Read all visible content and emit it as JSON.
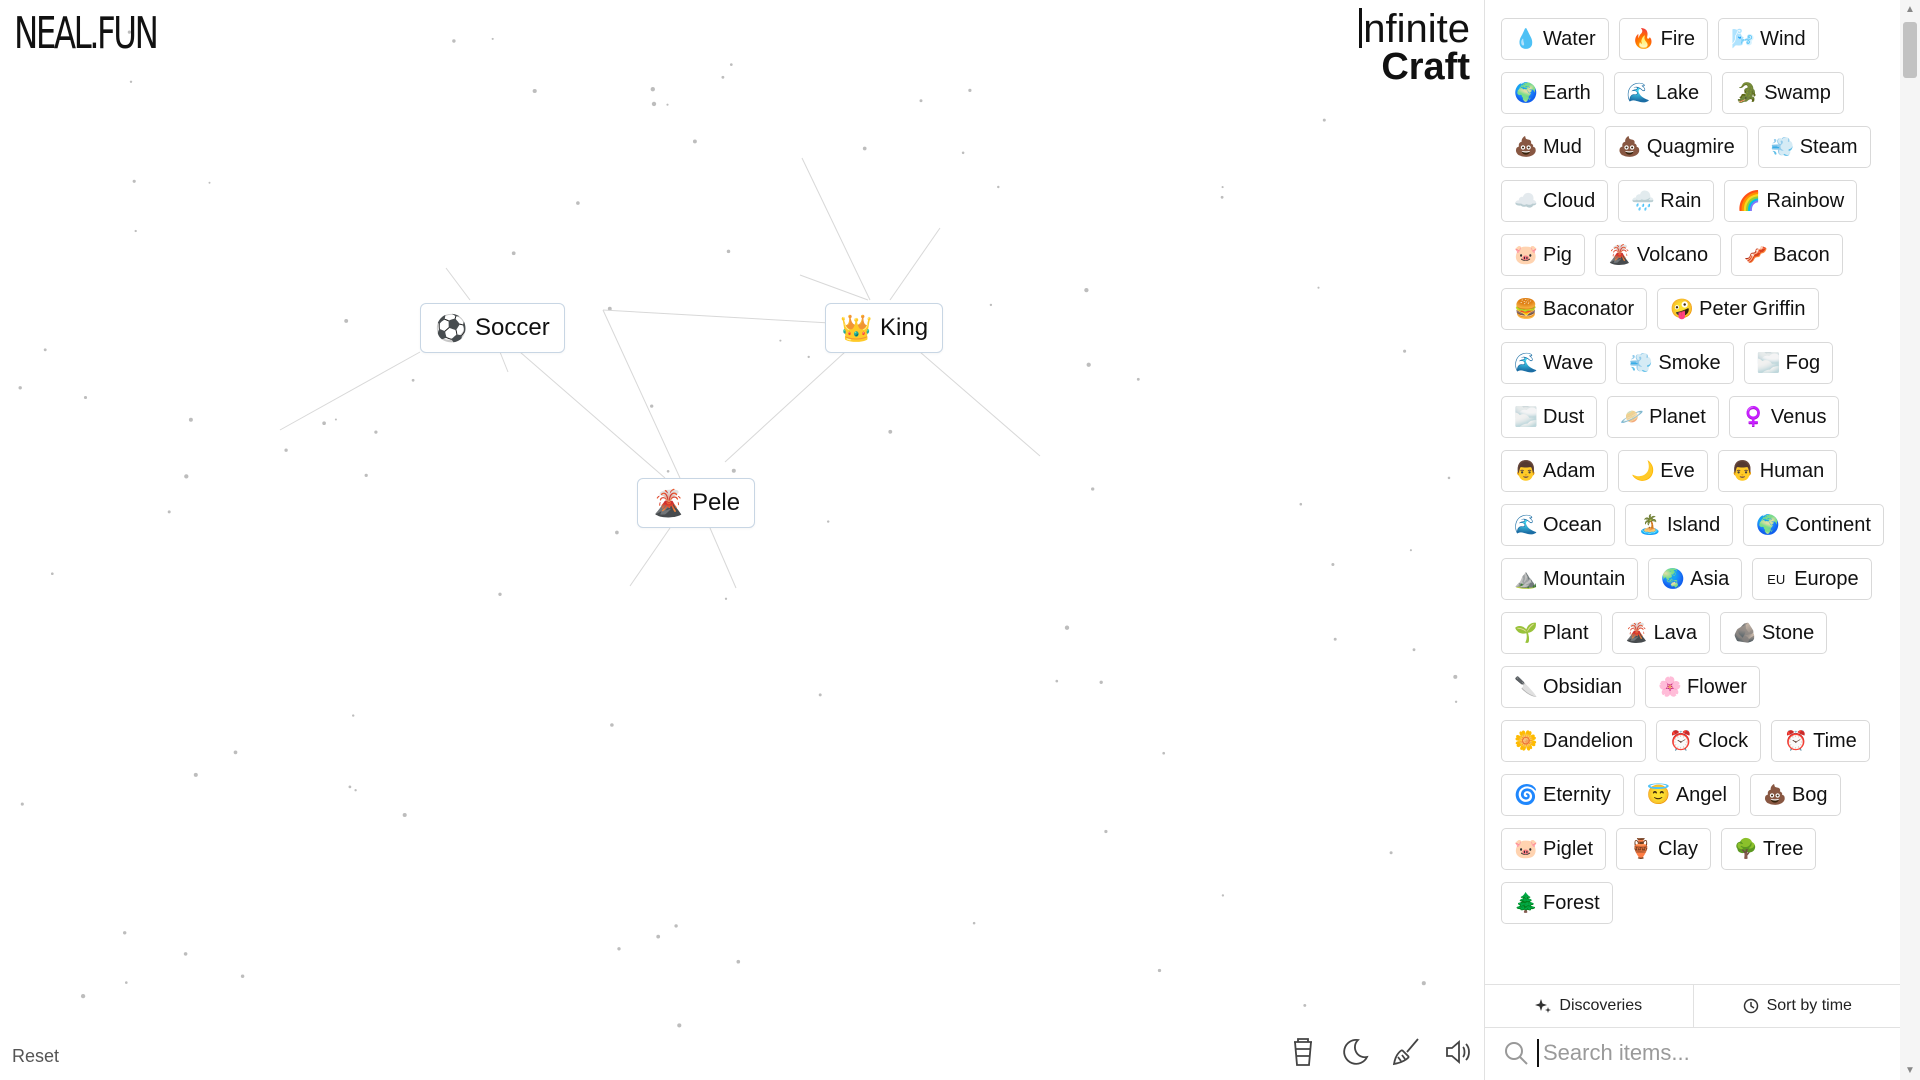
{
  "header": {
    "site_logo": "NEAL.FUN",
    "brand_line1": "nfinite",
    "brand_line2": "Craft"
  },
  "canvas": {
    "nodes": [
      {
        "label": "Soccer",
        "emoji": "⚽",
        "icon": "soccer-ball-icon"
      },
      {
        "label": "King",
        "emoji": "👑",
        "icon": "crown-icon"
      },
      {
        "label": "Pele",
        "emoji": "🌋",
        "icon": "volcano-icon"
      }
    ]
  },
  "footer": {
    "reset_label": "Reset",
    "tools": [
      "donate-cup-icon",
      "dark-mode-moon-icon",
      "clear-broom-icon",
      "sound-speaker-icon"
    ]
  },
  "sidebar": {
    "items": [
      {
        "emoji": "💧",
        "label": "Water"
      },
      {
        "emoji": "🔥",
        "label": "Fire"
      },
      {
        "emoji": "🌬️",
        "label": "Wind"
      },
      {
        "emoji": "🌍",
        "label": "Earth"
      },
      {
        "emoji": "🌊",
        "label": "Lake"
      },
      {
        "emoji": "🐊",
        "label": "Swamp"
      },
      {
        "emoji": "💩",
        "label": "Mud"
      },
      {
        "emoji": "💩",
        "label": "Quagmire"
      },
      {
        "emoji": "💨",
        "label": "Steam"
      },
      {
        "emoji": "☁️",
        "label": "Cloud"
      },
      {
        "emoji": "🌧️",
        "label": "Rain"
      },
      {
        "emoji": "🌈",
        "label": "Rainbow"
      },
      {
        "emoji": "🐷",
        "label": "Pig"
      },
      {
        "emoji": "🌋",
        "label": "Volcano"
      },
      {
        "emoji": "🥓",
        "label": "Bacon"
      },
      {
        "emoji": "🍔",
        "label": "Baconator"
      },
      {
        "emoji": "🤪",
        "label": "Peter Griffin"
      },
      {
        "emoji": "🌊",
        "label": "Wave"
      },
      {
        "emoji": "💨",
        "label": "Smoke"
      },
      {
        "emoji": "🌫️",
        "label": "Fog"
      },
      {
        "emoji": "🌫️",
        "label": "Dust"
      },
      {
        "emoji": "🪐",
        "label": "Planet"
      },
      {
        "emoji": "♀️",
        "label": "Venus"
      },
      {
        "emoji": "👨",
        "label": "Adam"
      },
      {
        "emoji": "🌙",
        "label": "Eve"
      },
      {
        "emoji": "👨",
        "label": "Human"
      },
      {
        "emoji": "🌊",
        "label": "Ocean"
      },
      {
        "emoji": "🏝️",
        "label": "Island"
      },
      {
        "emoji": "🌍",
        "label": "Continent"
      },
      {
        "emoji": "⛰️",
        "label": "Mountain"
      },
      {
        "emoji": "🌏",
        "label": "Asia"
      },
      {
        "emoji": "EU",
        "label": "Europe"
      },
      {
        "emoji": "🌱",
        "label": "Plant"
      },
      {
        "emoji": "🌋",
        "label": "Lava"
      },
      {
        "emoji": "🪨",
        "label": "Stone"
      },
      {
        "emoji": "🔪",
        "label": "Obsidian"
      },
      {
        "emoji": "🌸",
        "label": "Flower"
      },
      {
        "emoji": "🌼",
        "label": "Dandelion"
      },
      {
        "emoji": "⏰",
        "label": "Clock"
      },
      {
        "emoji": "⏰",
        "label": "Time"
      },
      {
        "emoji": "🌀",
        "label": "Eternity"
      },
      {
        "emoji": "😇",
        "label": "Angel"
      },
      {
        "emoji": "💩",
        "label": "Bog"
      },
      {
        "emoji": "🐷",
        "label": "Piglet"
      },
      {
        "emoji": "🏺",
        "label": "Clay"
      },
      {
        "emoji": "🌳",
        "label": "Tree"
      },
      {
        "emoji": "🌲",
        "label": "Forest"
      }
    ],
    "tabs": [
      {
        "label": "Discoveries",
        "icon": "sparkles-icon"
      },
      {
        "label": "Sort by time",
        "icon": "clock-icon"
      }
    ],
    "search": {
      "placeholder": "Search items...",
      "value": ""
    }
  }
}
